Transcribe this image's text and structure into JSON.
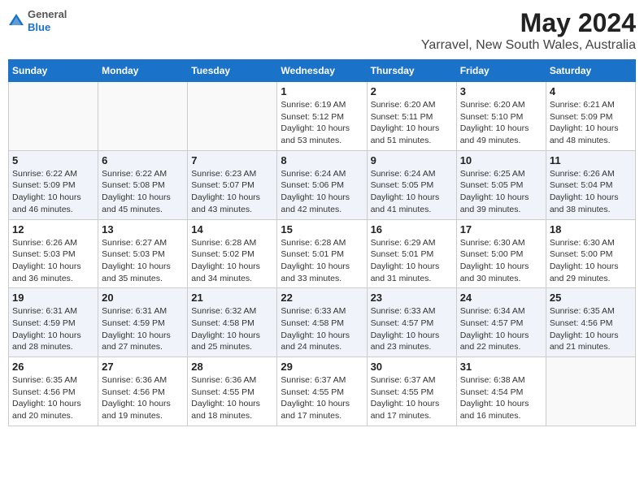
{
  "logo": {
    "general": "General",
    "blue": "Blue"
  },
  "title": "May 2024",
  "subtitle": "Yarravel, New South Wales, Australia",
  "days_of_week": [
    "Sunday",
    "Monday",
    "Tuesday",
    "Wednesday",
    "Thursday",
    "Friday",
    "Saturday"
  ],
  "weeks": [
    [
      {
        "day": "",
        "info": ""
      },
      {
        "day": "",
        "info": ""
      },
      {
        "day": "",
        "info": ""
      },
      {
        "day": "1",
        "info": "Sunrise: 6:19 AM\nSunset: 5:12 PM\nDaylight: 10 hours and 53 minutes."
      },
      {
        "day": "2",
        "info": "Sunrise: 6:20 AM\nSunset: 5:11 PM\nDaylight: 10 hours and 51 minutes."
      },
      {
        "day": "3",
        "info": "Sunrise: 6:20 AM\nSunset: 5:10 PM\nDaylight: 10 hours and 49 minutes."
      },
      {
        "day": "4",
        "info": "Sunrise: 6:21 AM\nSunset: 5:09 PM\nDaylight: 10 hours and 48 minutes."
      }
    ],
    [
      {
        "day": "5",
        "info": "Sunrise: 6:22 AM\nSunset: 5:09 PM\nDaylight: 10 hours and 46 minutes."
      },
      {
        "day": "6",
        "info": "Sunrise: 6:22 AM\nSunset: 5:08 PM\nDaylight: 10 hours and 45 minutes."
      },
      {
        "day": "7",
        "info": "Sunrise: 6:23 AM\nSunset: 5:07 PM\nDaylight: 10 hours and 43 minutes."
      },
      {
        "day": "8",
        "info": "Sunrise: 6:24 AM\nSunset: 5:06 PM\nDaylight: 10 hours and 42 minutes."
      },
      {
        "day": "9",
        "info": "Sunrise: 6:24 AM\nSunset: 5:05 PM\nDaylight: 10 hours and 41 minutes."
      },
      {
        "day": "10",
        "info": "Sunrise: 6:25 AM\nSunset: 5:05 PM\nDaylight: 10 hours and 39 minutes."
      },
      {
        "day": "11",
        "info": "Sunrise: 6:26 AM\nSunset: 5:04 PM\nDaylight: 10 hours and 38 minutes."
      }
    ],
    [
      {
        "day": "12",
        "info": "Sunrise: 6:26 AM\nSunset: 5:03 PM\nDaylight: 10 hours and 36 minutes."
      },
      {
        "day": "13",
        "info": "Sunrise: 6:27 AM\nSunset: 5:03 PM\nDaylight: 10 hours and 35 minutes."
      },
      {
        "day": "14",
        "info": "Sunrise: 6:28 AM\nSunset: 5:02 PM\nDaylight: 10 hours and 34 minutes."
      },
      {
        "day": "15",
        "info": "Sunrise: 6:28 AM\nSunset: 5:01 PM\nDaylight: 10 hours and 33 minutes."
      },
      {
        "day": "16",
        "info": "Sunrise: 6:29 AM\nSunset: 5:01 PM\nDaylight: 10 hours and 31 minutes."
      },
      {
        "day": "17",
        "info": "Sunrise: 6:30 AM\nSunset: 5:00 PM\nDaylight: 10 hours and 30 minutes."
      },
      {
        "day": "18",
        "info": "Sunrise: 6:30 AM\nSunset: 5:00 PM\nDaylight: 10 hours and 29 minutes."
      }
    ],
    [
      {
        "day": "19",
        "info": "Sunrise: 6:31 AM\nSunset: 4:59 PM\nDaylight: 10 hours and 28 minutes."
      },
      {
        "day": "20",
        "info": "Sunrise: 6:31 AM\nSunset: 4:59 PM\nDaylight: 10 hours and 27 minutes."
      },
      {
        "day": "21",
        "info": "Sunrise: 6:32 AM\nSunset: 4:58 PM\nDaylight: 10 hours and 25 minutes."
      },
      {
        "day": "22",
        "info": "Sunrise: 6:33 AM\nSunset: 4:58 PM\nDaylight: 10 hours and 24 minutes."
      },
      {
        "day": "23",
        "info": "Sunrise: 6:33 AM\nSunset: 4:57 PM\nDaylight: 10 hours and 23 minutes."
      },
      {
        "day": "24",
        "info": "Sunrise: 6:34 AM\nSunset: 4:57 PM\nDaylight: 10 hours and 22 minutes."
      },
      {
        "day": "25",
        "info": "Sunrise: 6:35 AM\nSunset: 4:56 PM\nDaylight: 10 hours and 21 minutes."
      }
    ],
    [
      {
        "day": "26",
        "info": "Sunrise: 6:35 AM\nSunset: 4:56 PM\nDaylight: 10 hours and 20 minutes."
      },
      {
        "day": "27",
        "info": "Sunrise: 6:36 AM\nSunset: 4:56 PM\nDaylight: 10 hours and 19 minutes."
      },
      {
        "day": "28",
        "info": "Sunrise: 6:36 AM\nSunset: 4:55 PM\nDaylight: 10 hours and 18 minutes."
      },
      {
        "day": "29",
        "info": "Sunrise: 6:37 AM\nSunset: 4:55 PM\nDaylight: 10 hours and 17 minutes."
      },
      {
        "day": "30",
        "info": "Sunrise: 6:37 AM\nSunset: 4:55 PM\nDaylight: 10 hours and 17 minutes."
      },
      {
        "day": "31",
        "info": "Sunrise: 6:38 AM\nSunset: 4:54 PM\nDaylight: 10 hours and 16 minutes."
      },
      {
        "day": "",
        "info": ""
      }
    ]
  ]
}
